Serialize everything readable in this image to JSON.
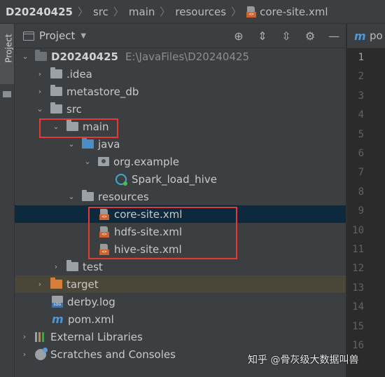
{
  "breadcrumb": {
    "project": "D20240425",
    "src": "src",
    "main": "main",
    "resources": "resources",
    "file": "core-site.xml"
  },
  "side_strip": {
    "tab_label": "Project"
  },
  "panel": {
    "title": "Project"
  },
  "tree": {
    "root_name": "D20240425",
    "root_path": "E:\\JavaFiles\\D20240425",
    "idea": ".idea",
    "metastore": "metastore_db",
    "src": "src",
    "main": "main",
    "java": "java",
    "org_example": "org.example",
    "spark_class": "Spark_load_hive",
    "resources": "resources",
    "core_site": "core-site.xml",
    "hdfs_site": "hdfs-site.xml",
    "hive_site": "hive-site.xml",
    "test": "test",
    "target": "target",
    "derby_log": "derby.log",
    "pom": "pom.xml",
    "external_libraries": "External Libraries",
    "scratches": "Scratches and Consoles"
  },
  "editor": {
    "tab_label": "po",
    "line_numbers": [
      "1",
      "2",
      "3",
      "4",
      "5",
      "6",
      "7",
      "8",
      "9",
      "10",
      "11",
      "12",
      "13",
      "14",
      "15",
      "16"
    ]
  },
  "watermark": "知乎 @骨灰级大数据叫兽"
}
